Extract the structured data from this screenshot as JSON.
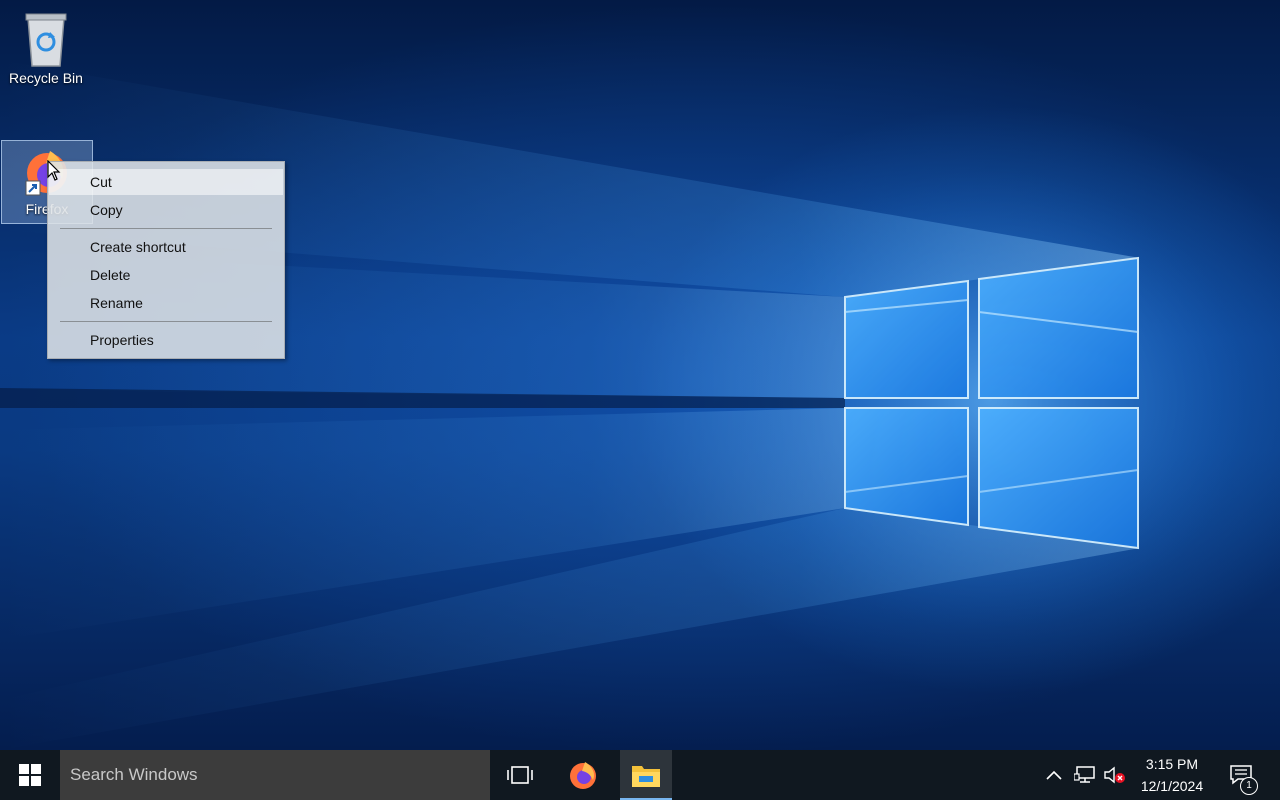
{
  "desktop": {
    "icons": [
      {
        "label": "Recycle Bin",
        "icon": "recycle-bin-icon"
      },
      {
        "label": "Firefox",
        "icon": "firefox-shortcut-icon",
        "selected": true
      }
    ]
  },
  "context_menu": {
    "items": [
      {
        "label": "Cut"
      },
      {
        "label": "Copy"
      },
      {
        "label": "Create shortcut"
      },
      {
        "label": "Delete"
      },
      {
        "label": "Rename"
      },
      {
        "label": "Properties"
      }
    ],
    "highlighted": "Cut"
  },
  "taskbar": {
    "start_icon": "windows-logo-icon",
    "search_placeholder": "Search Windows",
    "pinned": [
      {
        "name": "Task View",
        "icon": "task-view-icon"
      },
      {
        "name": "Firefox",
        "icon": "firefox-icon"
      },
      {
        "name": "File Explorer",
        "icon": "file-explorer-icon",
        "active": true
      }
    ],
    "tray": {
      "time": "3:15 PM",
      "date": "12/1/2024",
      "notification_count": "1"
    }
  },
  "colors": {
    "taskbar": "#101820",
    "search_box": "#3c3c3c",
    "active_indicator": "#78b6f0"
  }
}
